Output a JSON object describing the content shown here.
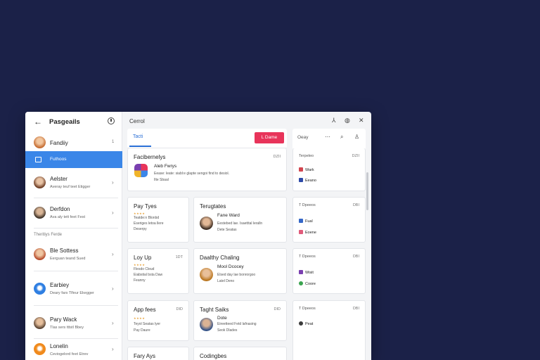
{
  "sidebar": {
    "title": "Pasgeails",
    "top_item": {
      "name": "Fandiiy",
      "badge": "1"
    },
    "active_item": {
      "label": "Futhoos"
    },
    "items": [
      {
        "name": "Aelster",
        "sub": "Averay teuf teet Etigger"
      },
      {
        "name": "Derfdon",
        "sub": "Ava aly tett feet Fest"
      },
      {
        "name": "Ble Sottess",
        "sub": "Eerguan teand Sued"
      },
      {
        "name": "Earbiey",
        "sub": "Deary fars Tlfeur Ekegger"
      },
      {
        "name": "Pary Wack",
        "sub": "Tlas sers tttstl Bbey"
      },
      {
        "name": "Lonelin",
        "sub": "Ceviogelord feet Etrev"
      }
    ],
    "section_label": "Theritiys Ferde"
  },
  "toolbar": {
    "title": "Cerrol"
  },
  "tabs": {
    "active": "Tacti",
    "button_label": "L Dame"
  },
  "cards": {
    "c1": {
      "title": "Facibernelys",
      "badge": "DZII",
      "t1": "Aleb Fwrys",
      "t2a": "Eease: leate: siabl:e glapte sengoi find to desiol.",
      "t2b": "Ilte Sbaal"
    },
    "c2": {
      "title": "Pay Tyes",
      "t2a": "Teatde:n Blonbd",
      "t2b": "Eseriges letoa llere",
      "t2c": "Deserpy"
    },
    "c3": {
      "title": "Terugtates",
      "t1": "Fane Ward",
      "t2a": "Eestebed lae. Isaetttal leralln",
      "t2b": "Dete Seatas"
    },
    "c4": {
      "title": "Loy Up",
      "badge": "1DT",
      "t2a": "Flesdo Cleud",
      "t2b": "Eiabstial bsta Daw",
      "t2c": "Feanny"
    },
    "c5": {
      "title": "Daalthy Chaling",
      "t1": "Mool Dcocey",
      "t2a": "Elsed day lae bonrorgoo",
      "t2b": "Latel Deno"
    },
    "c6": {
      "title": "App fees",
      "badge": "DID",
      "t2a": "Teyol Seatas lyer",
      "t2b": "Pay Daure"
    },
    "c7": {
      "title": "Taght Saiks",
      "badge": "DID",
      "t1": "Dote",
      "t2a": "Eireetteed Fetd lafnasing",
      "t2b": "Seok Dlades"
    },
    "c8": {
      "title": "Fary Ays"
    },
    "c9": {
      "title": "Codingbes"
    }
  },
  "right_column": {
    "header": "Oeay",
    "cards": [
      {
        "h": "Terpeleo",
        "hr": "DZII",
        "items": [
          {
            "label": "Wark",
            "color": "#d2454f"
          },
          {
            "label": "Eeano",
            "color": "#2e4aa8"
          }
        ]
      },
      {
        "h": "T Dpeeos",
        "hr": "DBI",
        "items": [
          {
            "label": "Fual",
            "color": "#3567c8"
          },
          {
            "label": "Eoene",
            "color": "#e05a7a"
          }
        ]
      },
      {
        "h": "T Dpeeos",
        "hr": "DBI",
        "items": [
          {
            "label": "Wisit",
            "color": "#7a3fb0"
          },
          {
            "label": "Coore",
            "color": "#3aa34f"
          }
        ]
      },
      {
        "h": "T Dpeeos",
        "hr": "DBI",
        "items": [
          {
            "label": "Peat",
            "color": "#3b3b3b"
          }
        ]
      }
    ]
  }
}
